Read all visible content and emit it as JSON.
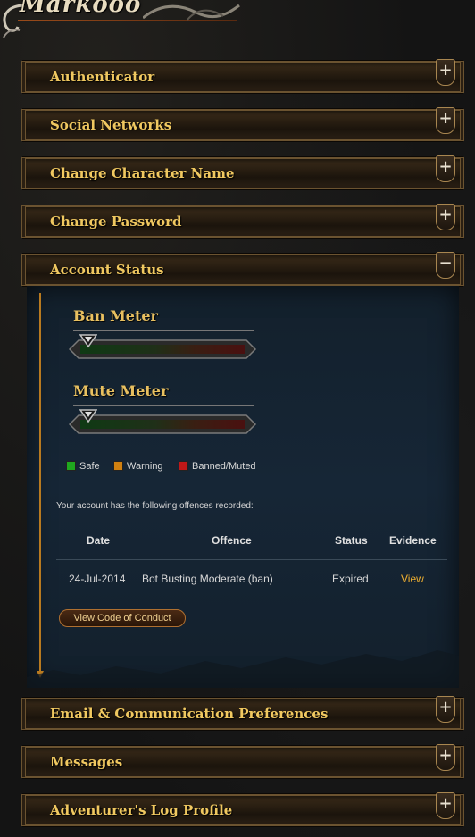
{
  "header": {
    "username": "Markooo"
  },
  "sections_top": [
    {
      "title": "Authenticator",
      "toggle": "+"
    },
    {
      "title": "Social Networks",
      "toggle": "+"
    },
    {
      "title": "Change Character Name",
      "toggle": "+"
    },
    {
      "title": "Change Password",
      "toggle": "+"
    },
    {
      "title": "Account Status",
      "toggle": "−"
    }
  ],
  "account_status": {
    "ban_meter": {
      "label": "Ban Meter",
      "level": 0.05
    },
    "mute_meter": {
      "label": "Mute Meter",
      "level": 0.05
    },
    "legend": [
      {
        "label": "Safe",
        "color": "#1fa81f"
      },
      {
        "label": "Warning",
        "color": "#d08010"
      },
      {
        "label": "Banned/Muted",
        "color": "#c01818"
      }
    ],
    "offences_intro": "Your account has the following offences recorded:",
    "table": {
      "headers": [
        "Date",
        "Offence",
        "Status",
        "Evidence"
      ],
      "rows": [
        {
          "date": "24-Jul-2014",
          "offence": "Bot Busting Moderate (ban)",
          "status": "Expired",
          "evidence": "View"
        }
      ]
    },
    "code_of_conduct_button": "View Code of Conduct"
  },
  "sections_bottom": [
    {
      "title": "Email & Communication Preferences",
      "toggle": "+"
    },
    {
      "title": "Messages",
      "toggle": "+"
    },
    {
      "title": "Adventurer's Log Profile",
      "toggle": "+"
    }
  ],
  "colors": {
    "accent": "#f0c860",
    "link": "#f0b030",
    "panel": "#162636"
  }
}
